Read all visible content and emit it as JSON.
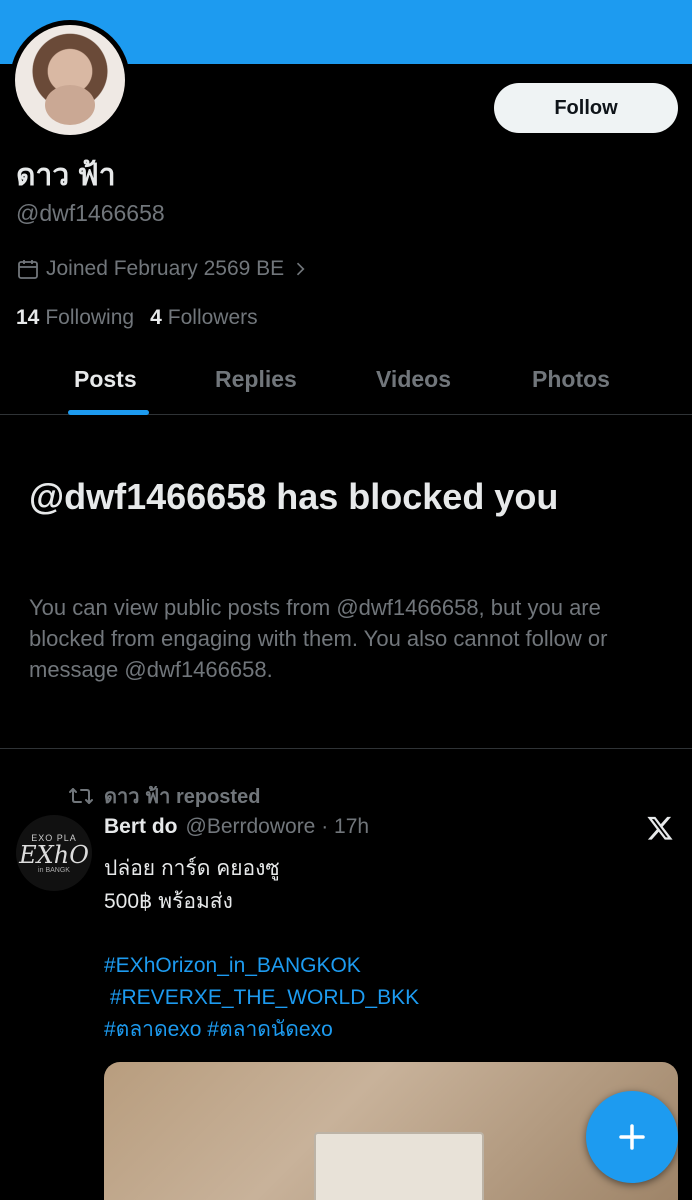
{
  "header": {
    "banner_color": "#1d9bf0"
  },
  "profile": {
    "display_name": "ดาว ฟ้า",
    "handle": "@dwf1466658",
    "joined": "Joined February 2569 BE",
    "follow_label": "Follow",
    "following_count": "14",
    "following_label": "Following",
    "followers_count": "4",
    "followers_label": "Followers"
  },
  "tabs": [
    {
      "label": "Posts",
      "active": true
    },
    {
      "label": "Replies",
      "active": false
    },
    {
      "label": "Videos",
      "active": false
    },
    {
      "label": "Photos",
      "active": false
    }
  ],
  "blocked_notice": {
    "title": "@dwf1466658 has blocked you",
    "description": "You can view public posts from @dwf1466658, but you are blocked from engaging with them. You also cannot follow or message @dwf1466658."
  },
  "post": {
    "repost_label": "ดาว ฟ้า reposted",
    "author_name": "Bert do",
    "author_meta": "@Berrdowore · 17h",
    "avatar_text": {
      "line1": "EXO PLA",
      "line2": "EXhO",
      "line3": "in BANGK"
    },
    "text_line1": "ปล่อย การ์ด คยองซู",
    "text_line2": "500฿ พร้อมส่ง",
    "hashtags": [
      "#EXhOrizon_in_BANGKOK",
      " #REVERXE_THE_WORLD_BKK",
      "#ตลาดexo #ตลาดนัดexo"
    ]
  },
  "icons": {
    "calendar": "calendar-icon",
    "chevron": "chevron-right-icon",
    "repost": "repost-icon",
    "x_logo": "x-logo-icon",
    "compose": "plus-icon"
  },
  "colors": {
    "accent": "#1d9bf0",
    "background": "#000000",
    "text_primary": "#e7e9ea",
    "text_secondary": "#71767b"
  }
}
